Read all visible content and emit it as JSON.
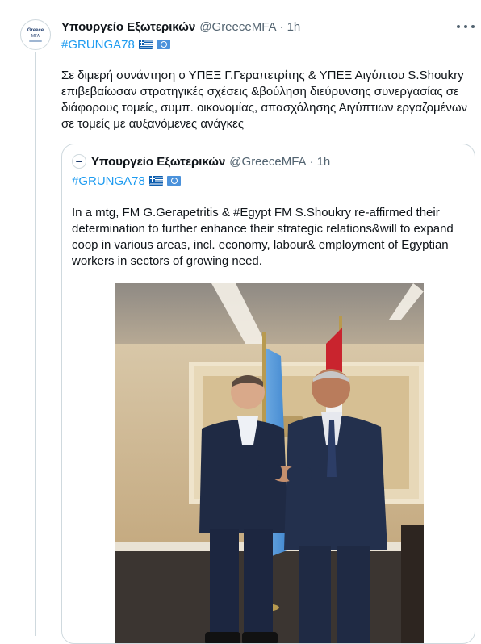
{
  "tweet": {
    "author_name": "Υπουργείο Εξωτερικών",
    "handle": "@GreeceMFA",
    "separator": "·",
    "time": "1h",
    "hashtag": "#GRUNGA78",
    "text": "Σε διμερή συνάντηση ο ΥΠΕΞ Γ.Γεραπετρίτης & ΥΠΕΞ Αιγύπτου S.Shoukry επιβεβαίωσαν στρατηγικές σχέσεις &βούληση διεύρυνσης συνεργασίας σε διάφορους τομείς, συμπ. οικονομίας, απασχόλησης Αιγύπτιων εργαζομένων σε τομείς με αυξανόμενες ανάγκες",
    "avatar_text_1": "Greece",
    "avatar_text_2": "MFA",
    "icons": {
      "more": "more-options-icon",
      "flag_greece": "greece-flag-icon",
      "flag_un": "un-flag-icon"
    }
  },
  "quoted_tweet": {
    "author_name": "Υπουργείο Εξωτερικών",
    "handle": "@GreeceMFA",
    "separator": "·",
    "time": "1h",
    "hashtag": "#GRUNGA78",
    "text": "In a mtg, FM G.Gerapetritis & #Egypt FM S.Shoukry re-affirmed their determination to further enhance their strategic relations&will to expand coop in various areas, incl. economy, labour& employment of Egyptian workers in sectors of growing need."
  },
  "colors": {
    "link": "#1d9bf0",
    "secondary_text": "#536471",
    "border": "#cfd9de"
  }
}
